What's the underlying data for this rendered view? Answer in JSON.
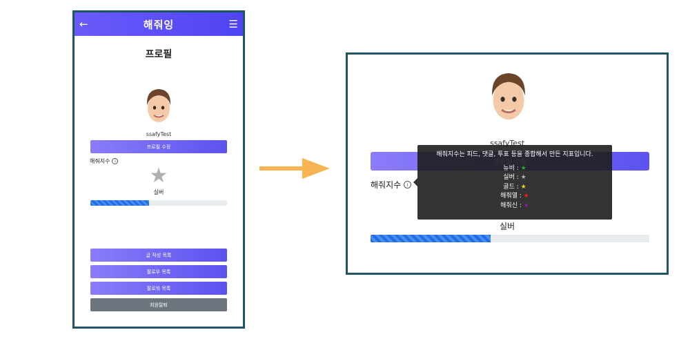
{
  "app": {
    "brand": "해줘잉",
    "back_icon": "arrow-left-icon",
    "menu_icon": "hamburger-menu-icon"
  },
  "profile": {
    "page_title": "프로필",
    "username": "ssafyTest",
    "edit_button": "프로필 수정",
    "score_label": "해줘지수",
    "info_icon_glyph": "i",
    "rank": "실버",
    "rank_star_color": "#b0b0b0",
    "progress_percent": 43
  },
  "actions": {
    "posts": "글 작성 목록",
    "following": "팔로우 목록",
    "followers": "팔로워 목록",
    "withdraw": "회원탈퇴"
  },
  "tooltip": {
    "description": "해줘지수는 피드, 댓글, 투표 등을 종합해서 만든 지표입니다.",
    "ranks": [
      {
        "label": "뉴비 :",
        "star": "★",
        "color": "#2eab2e"
      },
      {
        "label": "실버 :",
        "star": "★",
        "color": "#b0b0b0"
      },
      {
        "label": "골드 :",
        "star": "★",
        "color": "#f2d21b"
      },
      {
        "label": "해줘열 :",
        "star": "★",
        "color": "#e8261f"
      },
      {
        "label": "해줘신 :",
        "star": "★",
        "color": "#8a1fa0"
      }
    ]
  },
  "colors": {
    "accent": "#5c52f0",
    "frame": "#1d5563",
    "arrow": "#f6b452"
  }
}
